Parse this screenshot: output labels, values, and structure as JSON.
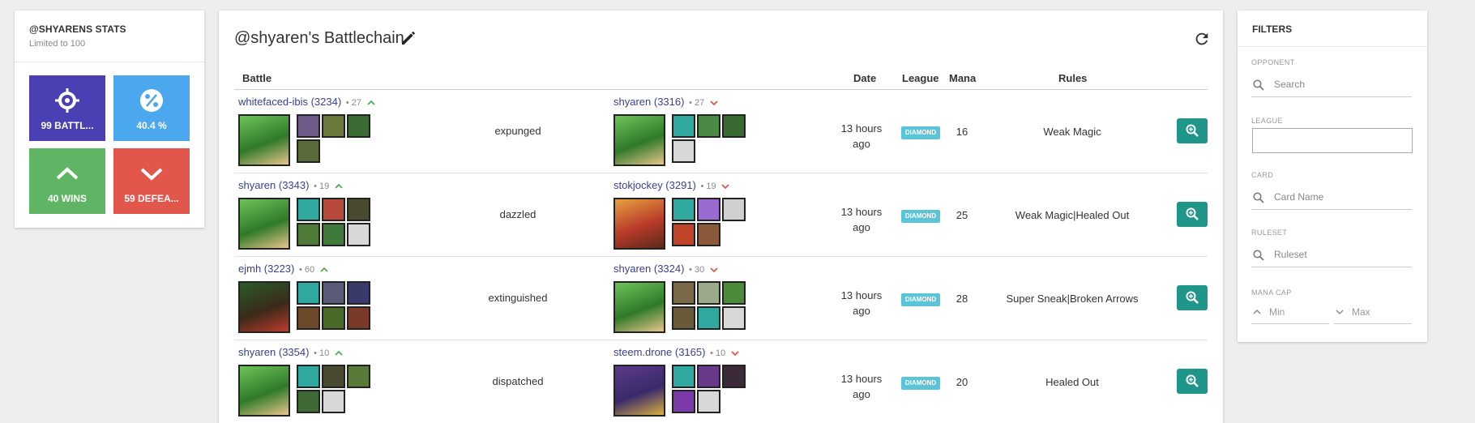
{
  "stats": {
    "title": "@SHYARENS STATS",
    "subtitle": "Limited to 100",
    "tiles": [
      {
        "label": "99 BATTL...",
        "icon": "crosshair-icon",
        "color": "#4a40b4"
      },
      {
        "label": "40.4 %",
        "icon": "percent-icon",
        "color": "#4ba7ee"
      },
      {
        "label": "40 WINS",
        "icon": "chevron-up-icon",
        "color": "#5fb563"
      },
      {
        "label": "59 DEFEA...",
        "icon": "chevron-down-icon",
        "color": "#e3564c"
      }
    ]
  },
  "main": {
    "title": "@shyaren's Battlechain",
    "columns": {
      "battle": "Battle",
      "date": "Date",
      "league": "League",
      "mana": "Mana",
      "rules": "Rules"
    },
    "rows": [
      {
        "p1": {
          "name": "whitefaced-ibis (3234)",
          "meta": "• 27",
          "result": "up"
        },
        "p2": {
          "name": "shyaren (3316)",
          "meta": "• 27",
          "result": "down"
        },
        "verb": "expunged",
        "date_line1": "13 hours",
        "date_line2": "ago",
        "league": "DIAMOND",
        "mana": "16",
        "rules": "Weak Magic"
      },
      {
        "p1": {
          "name": "shyaren (3343)",
          "meta": "• 19",
          "result": "up"
        },
        "p2": {
          "name": "stokjockey (3291)",
          "meta": "• 19",
          "result": "down"
        },
        "verb": "dazzled",
        "date_line1": "13 hours",
        "date_line2": "ago",
        "league": "DIAMOND",
        "mana": "25",
        "rules": "Weak Magic|Healed Out"
      },
      {
        "p1": {
          "name": "ejmh (3223)",
          "meta": "• 60",
          "result": "up"
        },
        "p2": {
          "name": "shyaren (3324)",
          "meta": "• 30",
          "result": "down"
        },
        "verb": "extinguished",
        "date_line1": "13 hours",
        "date_line2": "ago",
        "league": "DIAMOND",
        "mana": "28",
        "rules": "Super Sneak|Broken Arrows"
      },
      {
        "p1": {
          "name": "shyaren (3354)",
          "meta": "• 10",
          "result": "up"
        },
        "p2": {
          "name": "steem.drone (3165)",
          "meta": "• 10",
          "result": "down"
        },
        "verb": "dispatched",
        "date_line1": "13 hours",
        "date_line2": "ago",
        "league": "DIAMOND",
        "mana": "20",
        "rules": "Healed Out"
      }
    ]
  },
  "filters": {
    "title": "FILTERS",
    "opponent_label": "OPPONENT",
    "opponent_placeholder": "Search",
    "league_label": "LEAGUE",
    "card_label": "CARD",
    "card_placeholder": "Card Name",
    "ruleset_label": "RULESET",
    "ruleset_placeholder": "Ruleset",
    "mana_label": "MANA CAP",
    "min_placeholder": "Min",
    "max_placeholder": "Max"
  },
  "colors": {
    "accent": "#20968a",
    "league_badge": "#5bc4d8",
    "win_arrow": "#4caf50",
    "loss_arrow": "#e3564c",
    "link": "#3a3f8f"
  }
}
